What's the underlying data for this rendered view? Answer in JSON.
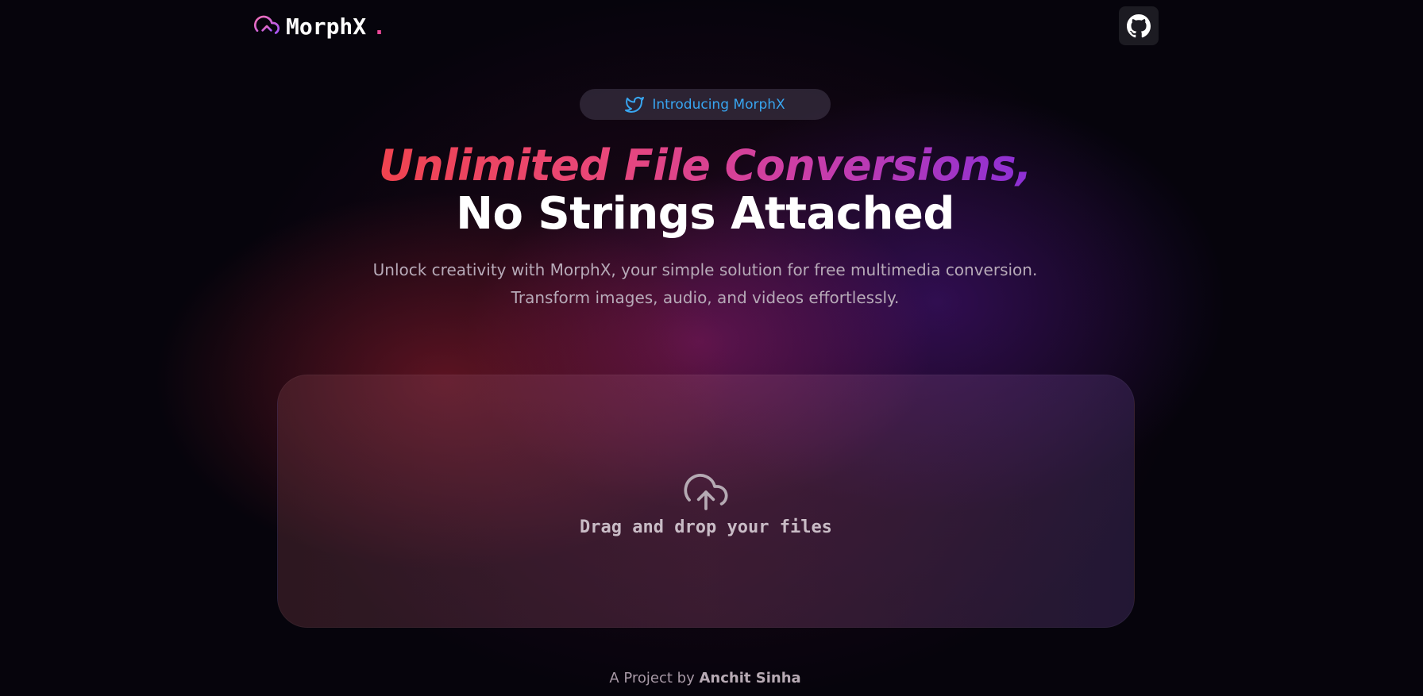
{
  "header": {
    "logo_text": "MorphX",
    "logo_dot": ".",
    "logo_icon": "cloud-upload-icon",
    "github_icon": "github-icon"
  },
  "badge": {
    "icon": "twitter-icon",
    "label": "Introducing MorphX"
  },
  "hero": {
    "title_line1": "Unlimited File Conversions,",
    "title_line2": "No Strings Attached",
    "subtitle_line1": "Unlock creativity with MorphX, your simple solution for free multimedia conversion.",
    "subtitle_line2": "Transform images, audio, and videos effortlessly."
  },
  "dropzone": {
    "icon": "cloud-upload-icon",
    "label": "Drag and drop your files"
  },
  "footer": {
    "prefix": "A Project by",
    "author": "Anchit Sinha"
  },
  "colors": {
    "background": "#06040c",
    "accent_pink": "#ec4899",
    "twitter_blue": "#38a5f0",
    "gradient_start": "#f0434f",
    "gradient_end": "#8b2fd6"
  }
}
